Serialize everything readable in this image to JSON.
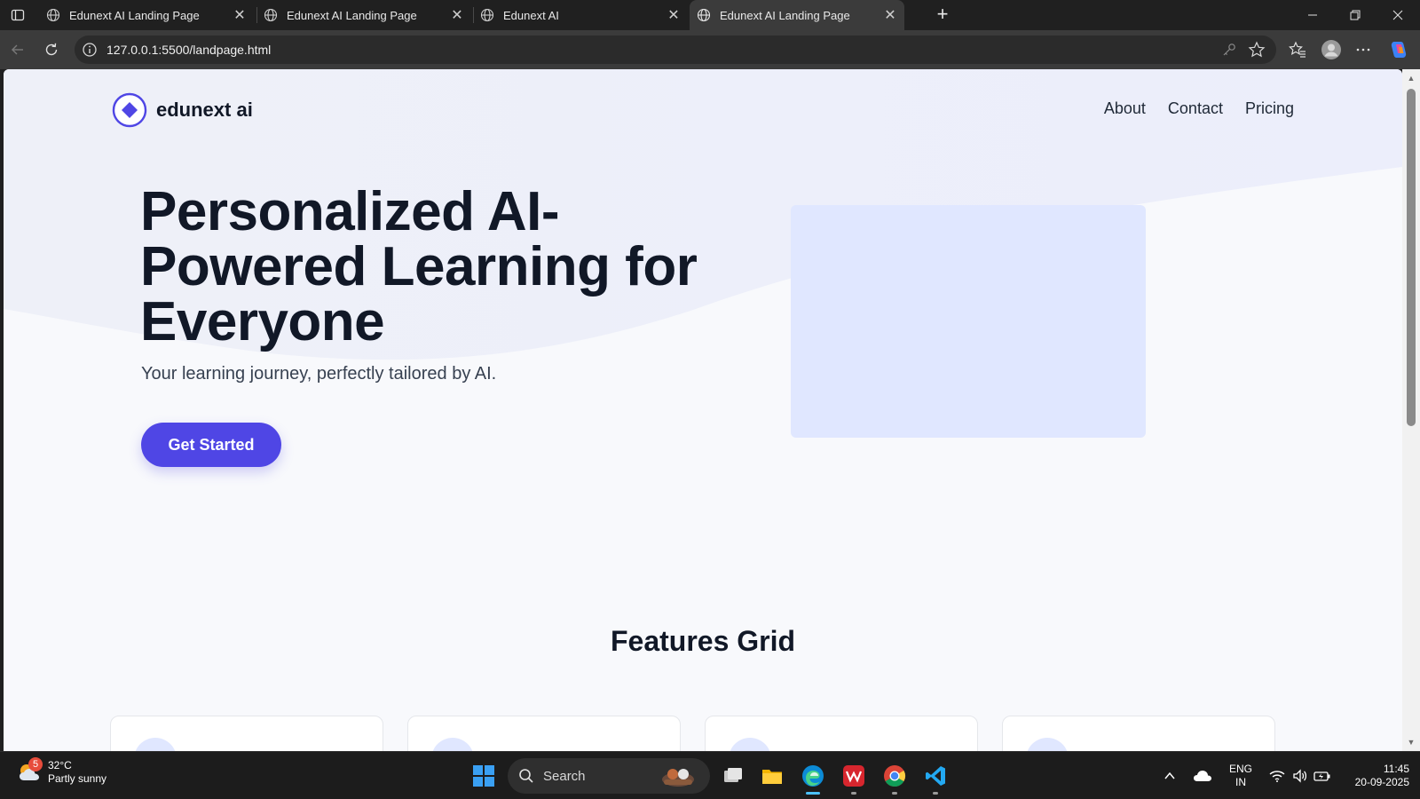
{
  "browser": {
    "tabs": [
      {
        "title": "Edunext AI Landing Page",
        "active": false
      },
      {
        "title": "Edunext AI Landing Page",
        "active": false
      },
      {
        "title": "Edunext AI",
        "active": false
      },
      {
        "title": "Edunext AI Landing Page",
        "active": true
      }
    ],
    "close_glyph": "✕",
    "url": "127.0.0.1:5500/landpage.html"
  },
  "page": {
    "brand": "edunext ai",
    "nav": [
      "About",
      "Contact",
      "Pricing"
    ],
    "hero_title": "Personalized AI-Powered Learning for Everyone",
    "hero_subtitle": "Your learning journey, perfectly tailored by AI.",
    "cta_label": "Get Started",
    "features_title": "Features Grid",
    "colors": {
      "accent": "#4f46e5",
      "placeholder": "#e0e7ff",
      "background": "#f8f9fc"
    }
  },
  "taskbar": {
    "weather_temp": "32°C",
    "weather_desc": "Partly sunny",
    "weather_badge": "5",
    "search_label": "Search",
    "lang_line1": "ENG",
    "lang_line2": "IN",
    "time": "11:45",
    "date": "20-09-2025",
    "pinned": [
      "task-view",
      "file-explorer",
      "edge",
      "wps-office",
      "chrome",
      "vscode"
    ]
  }
}
